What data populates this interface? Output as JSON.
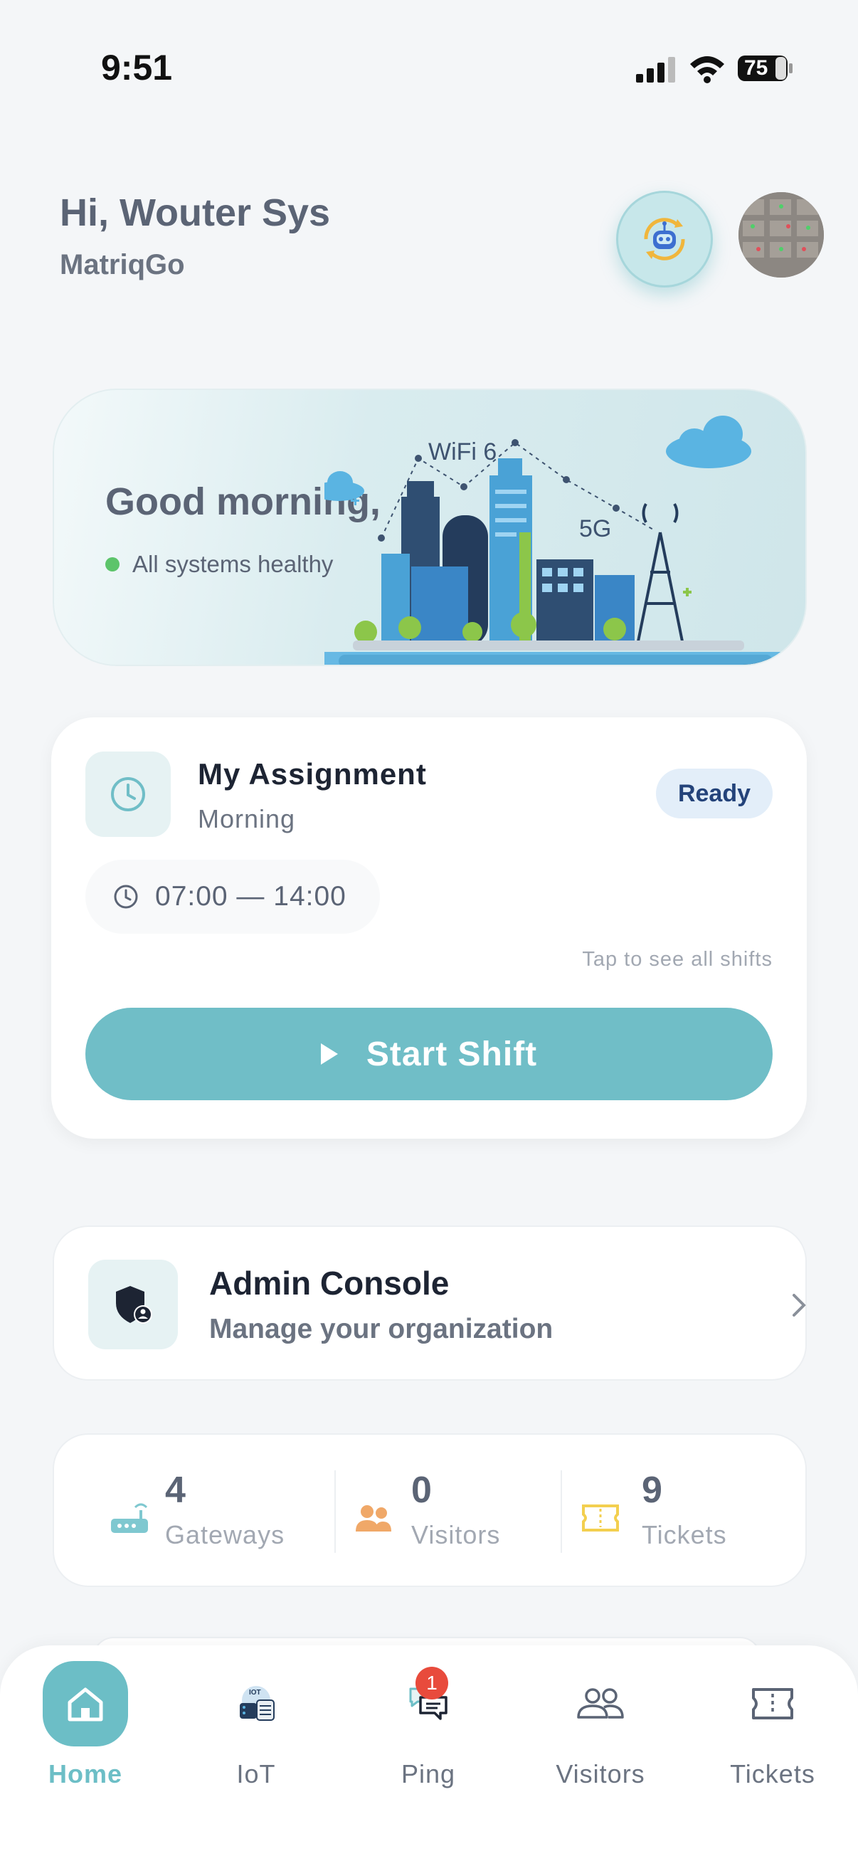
{
  "status_bar": {
    "time": "9:51",
    "battery": "75"
  },
  "header": {
    "greeting": "Hi, Wouter Sys",
    "org": "MatriqGo"
  },
  "hero": {
    "title": "Good morning,",
    "status": "All systems healthy",
    "art_labels": {
      "wifi": "WiFi 6",
      "cell": "5G"
    }
  },
  "assignment": {
    "title": "My Assignment",
    "subtitle": "Morning",
    "badge": "Ready",
    "time_range": "07:00 — 14:00",
    "hint": "Tap to see all shifts",
    "start_label": "Start Shift"
  },
  "admin": {
    "title": "Admin Console",
    "subtitle": "Manage your organization"
  },
  "stats": [
    {
      "value": "4",
      "label": "Gateways",
      "icon": "router-icon",
      "color": "#7fc8d0"
    },
    {
      "value": "0",
      "label": "Visitors",
      "icon": "people-icon",
      "color": "#f0a868"
    },
    {
      "value": "9",
      "label": "Tickets",
      "icon": "ticket-icon",
      "color": "#f3cf4f"
    }
  ],
  "nav": [
    {
      "label": "Home",
      "icon": "home-icon",
      "active": true
    },
    {
      "label": "IoT",
      "icon": "iot-icon"
    },
    {
      "label": "Ping",
      "icon": "chat-icon",
      "badge": "1"
    },
    {
      "label": "Visitors",
      "icon": "people-icon"
    },
    {
      "label": "Tickets",
      "icon": "ticket-icon"
    }
  ],
  "colors": {
    "accent": "#70bec7",
    "healthy": "#5cc46a",
    "badge": "#e84b3c"
  }
}
